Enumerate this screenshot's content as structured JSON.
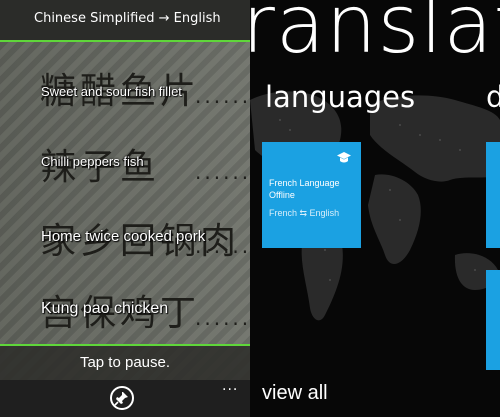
{
  "camera": {
    "language_pair": "Chinese Simplified → English",
    "items": [
      {
        "chinese": "糖醋鱼片",
        "english": "Sweet and sour fish fillet"
      },
      {
        "chinese": "辣子鱼",
        "english": "Chilli peppers fish"
      },
      {
        "chinese": "家乡回锅肉",
        "english": "Home twice cooked pork"
      },
      {
        "chinese": "宫保鸡丁",
        "english": "Kung pao chicken"
      }
    ],
    "pause_text": "Tap to pause.",
    "more": "...",
    "pin_icon": "pin-icon"
  },
  "translator": {
    "app_title": "ranslato",
    "section_languages": "languages",
    "section_next": "d",
    "tile": {
      "name": "French Language Offline",
      "pair": "French ⇆ English",
      "icon": "graduation-cap-icon",
      "color": "#1ba1e2"
    },
    "view_all": "view all"
  },
  "colors": {
    "accent_green": "#5fd63a",
    "tile_blue": "#1ba1e2"
  }
}
